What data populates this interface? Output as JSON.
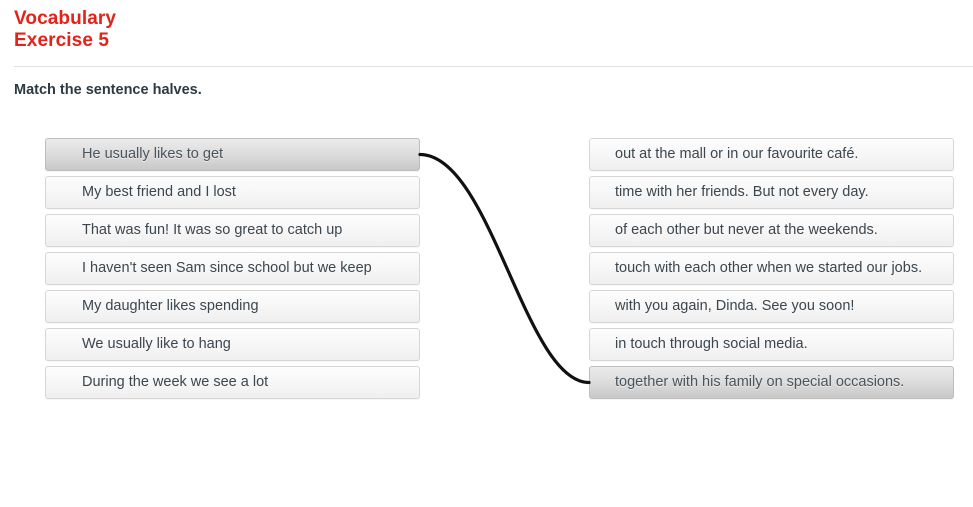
{
  "header": {
    "title_line1": "Vocabulary",
    "title_line2": "Exercise 5",
    "accent_color": "#e32219",
    "instruction": "Match the sentence halves."
  },
  "exercise": {
    "left_column": [
      {
        "text": "He usually likes to get",
        "selected": true
      },
      {
        "text": "My best friend and I lost",
        "selected": false
      },
      {
        "text": "That was fun! It was so great to catch up",
        "selected": false
      },
      {
        "text": "I haven't seen Sam since school but we keep",
        "selected": false
      },
      {
        "text": "My daughter likes spending",
        "selected": false
      },
      {
        "text": "We usually like to hang",
        "selected": false
      },
      {
        "text": "During the week we see a lot",
        "selected": false
      }
    ],
    "right_column": [
      {
        "text": "out at the mall or in our favourite café.",
        "selected": false
      },
      {
        "text": "time with her friends. But not every day.",
        "selected": false
      },
      {
        "text": "of each other but never at the weekends.",
        "selected": false
      },
      {
        "text": "touch with each other when we started our jobs.",
        "selected": false
      },
      {
        "text": "with you again, Dinda. See you soon!",
        "selected": false
      },
      {
        "text": "in touch through social media.",
        "selected": false
      },
      {
        "text": "together with his family on special occasions.",
        "selected": true
      }
    ],
    "connections": [
      {
        "from_index": 0,
        "to_index": 6,
        "color": "#111111"
      }
    ]
  }
}
